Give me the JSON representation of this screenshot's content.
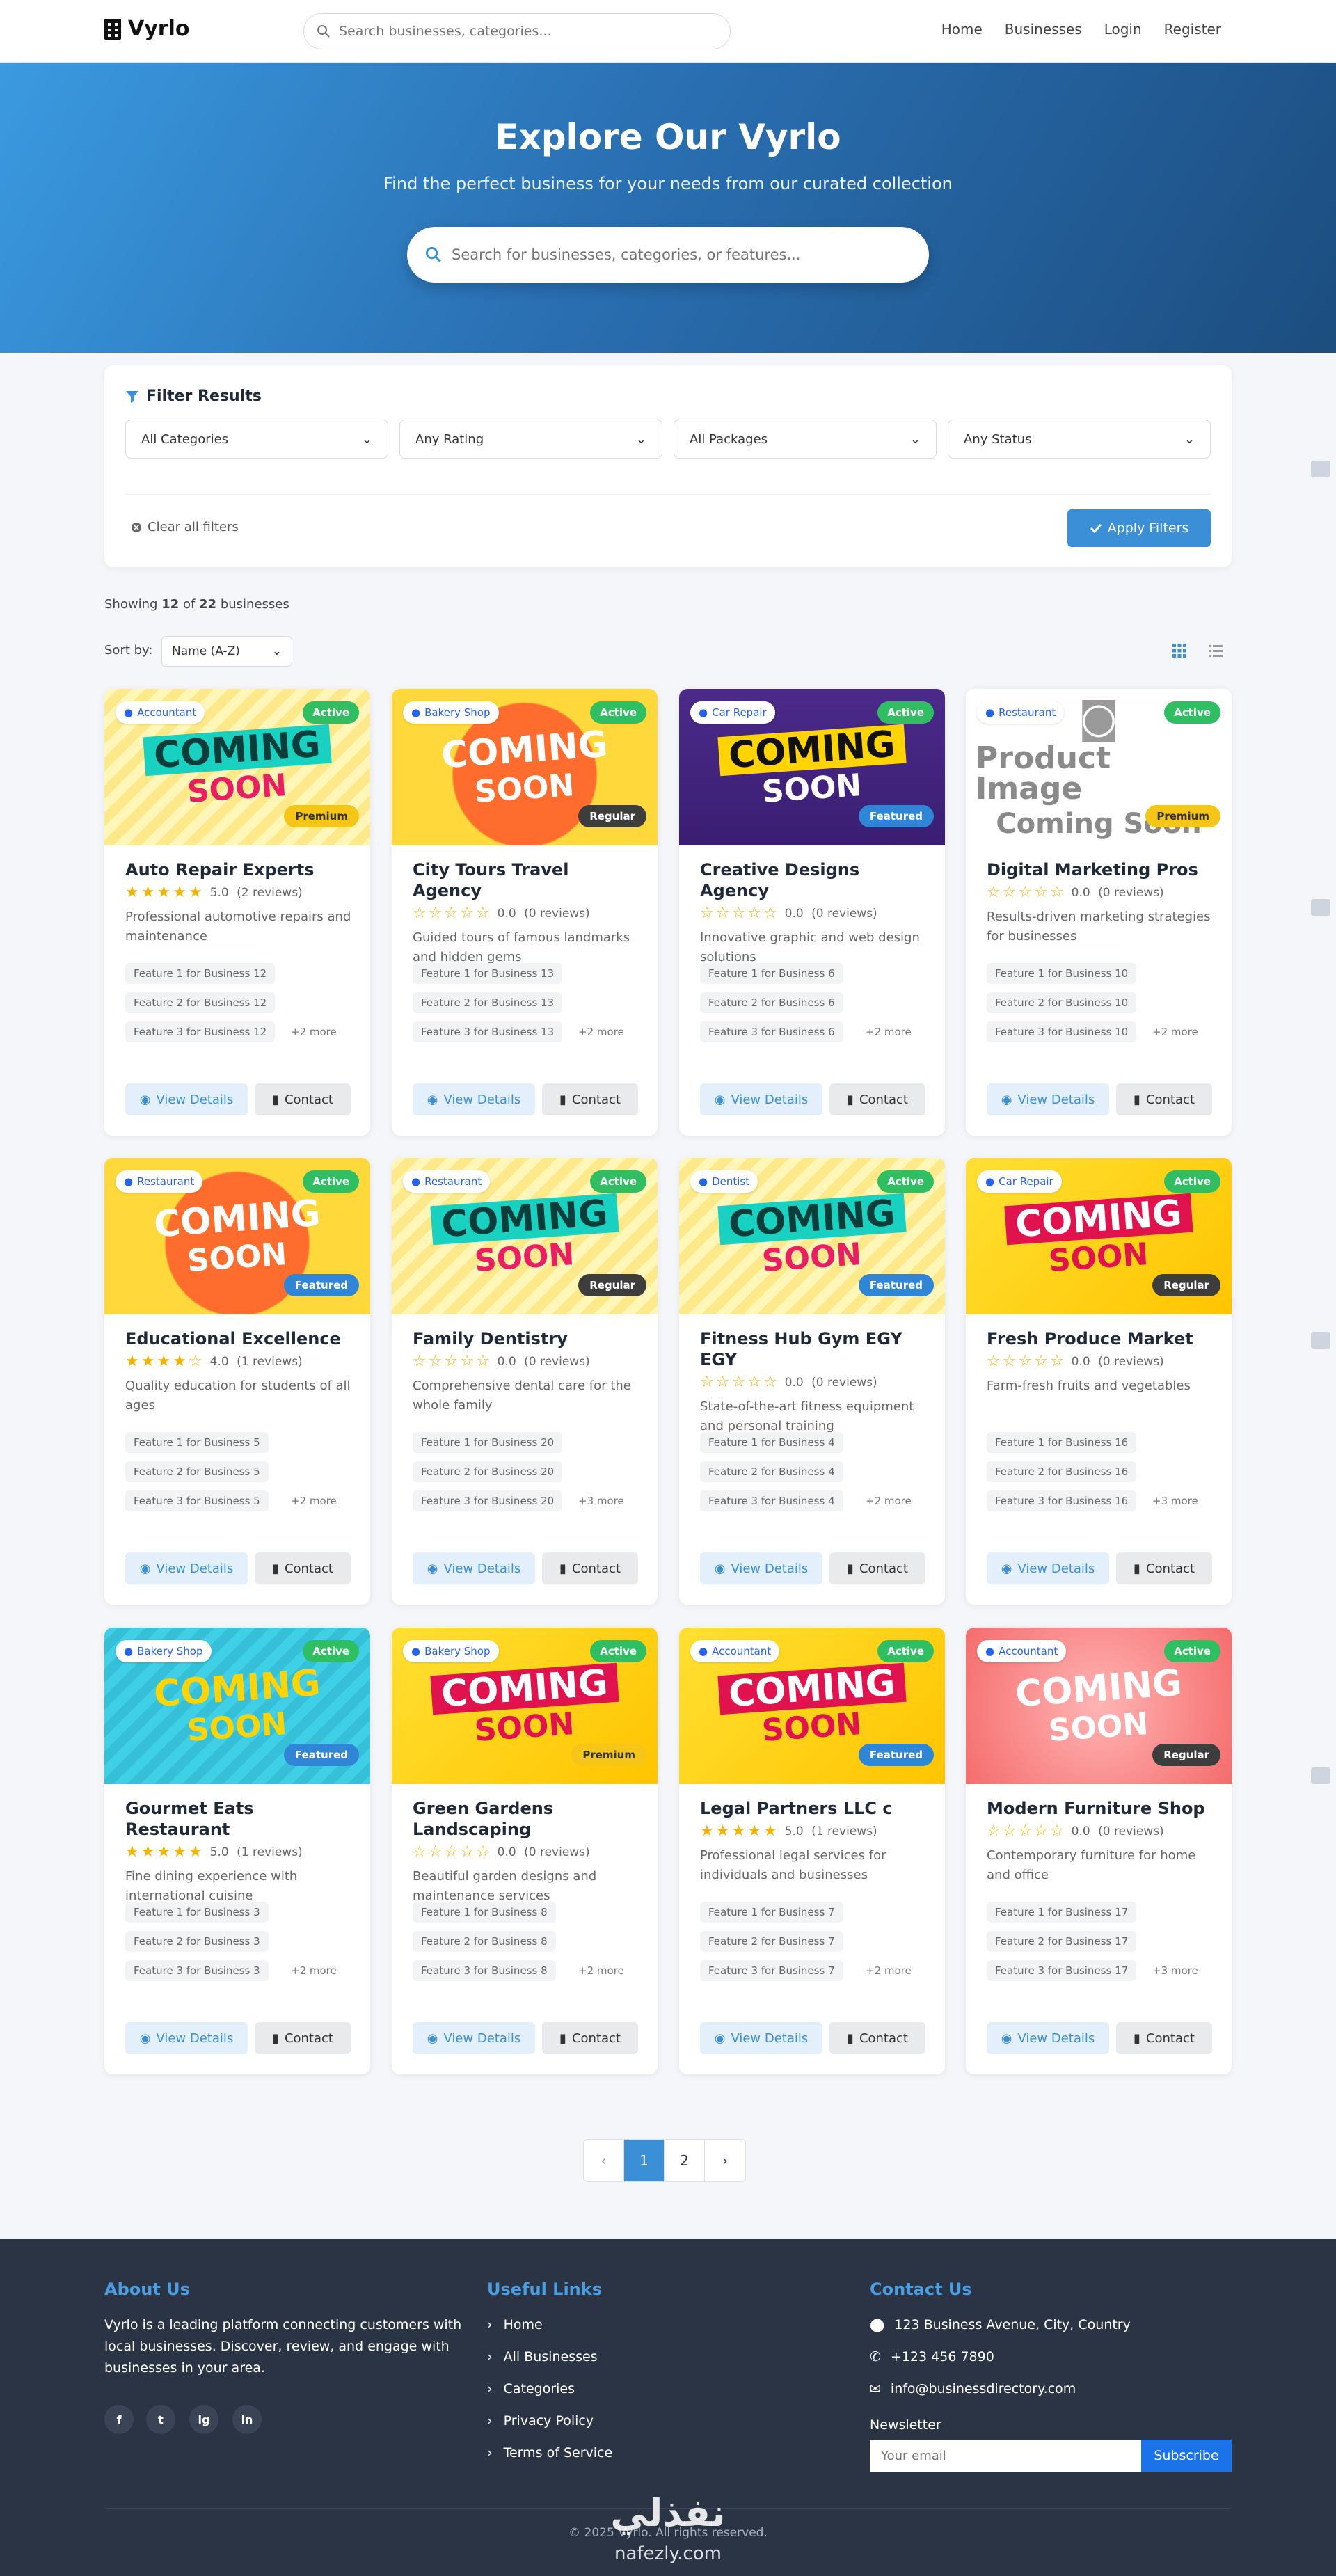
{
  "nav": {
    "logo": "Vyrlo",
    "search_placeholder": "Search businesses, categories...",
    "links": [
      "Home",
      "Businesses",
      "Login",
      "Register"
    ]
  },
  "hero": {
    "title": "Explore Our Vyrlo",
    "subtitle": "Find the perfect business for your needs from our curated collection",
    "search_placeholder": "Search for businesses, categories, or features..."
  },
  "filters": {
    "title": "Filter Results",
    "categories": "All Categories",
    "rating": "Any Rating",
    "packages": "All Packages",
    "status": "Any Status",
    "clear": "Clear all filters",
    "apply": "Apply Filters"
  },
  "results": {
    "showing_prefix": "Showing",
    "shown": "12",
    "of": "of",
    "total": "22",
    "suffix": "businesses",
    "sort_label": "Sort by:",
    "sort_value": "Name (A-Z)"
  },
  "actions": {
    "view": "View Details",
    "contact": "Contact"
  },
  "cards": [
    {
      "name": "Auto Repair Experts",
      "category": "Accountant",
      "status": "Active",
      "package": "Premium",
      "stars": 5,
      "rating": "5.0",
      "reviews": "(2 reviews)",
      "description": "Professional automotive repairs and maintenance",
      "features": [
        "Feature 1 for Business 12",
        "Feature 2 for Business 12",
        "Feature 3 for Business 12"
      ],
      "more": "+2 more",
      "image_text": [
        "COMING",
        "SOON"
      ]
    },
    {
      "name": "City Tours Travel Agency",
      "category": "Bakery Shop",
      "status": "Active",
      "package": "Regular",
      "stars": 0,
      "rating": "0.0",
      "reviews": "(0 reviews)",
      "description": "Guided tours of famous landmarks and hidden gems",
      "features": [
        "Feature 1 for Business 13",
        "Feature 2 for Business 13",
        "Feature 3 for Business 13"
      ],
      "more": "+2 more",
      "image_text": [
        "COMING",
        "SOON"
      ]
    },
    {
      "name": "Creative Designs Agency",
      "category": "Car Repair",
      "status": "Active",
      "package": "Featured",
      "stars": 0,
      "rating": "0.0",
      "reviews": "(0 reviews)",
      "description": "Innovative graphic and web design solutions",
      "features": [
        "Feature 1 for Business 6",
        "Feature 2 for Business 6",
        "Feature 3 for Business 6"
      ],
      "more": "+2 more",
      "image_text": [
        "COMING",
        "SOON"
      ]
    },
    {
      "name": "Digital Marketing Pros",
      "category": "Restaurant",
      "status": "Active",
      "package": "Premium",
      "stars": 0,
      "rating": "0.0",
      "reviews": "(0 reviews)",
      "description": "Results-driven marketing strategies for businesses",
      "features": [
        "Feature 1 for Business 10",
        "Feature 2 for Business 10",
        "Feature 3 for Business 10"
      ],
      "more": "+2 more",
      "image_text": [
        "Product Image",
        "Coming Soon"
      ]
    },
    {
      "name": "Educational Excellence",
      "category": "Restaurant",
      "status": "Active",
      "package": "Featured",
      "stars": 4,
      "rating": "4.0",
      "reviews": "(1 reviews)",
      "description": "Quality education for students of all ages",
      "features": [
        "Feature 1 for Business 5",
        "Feature 2 for Business 5",
        "Feature 3 for Business 5"
      ],
      "more": "+2 more",
      "image_text": [
        "COMING",
        "SOON"
      ]
    },
    {
      "name": "Family Dentistry",
      "category": "Restaurant",
      "status": "Active",
      "package": "Regular",
      "stars": 0,
      "rating": "0.0",
      "reviews": "(0 reviews)",
      "description": "Comprehensive dental care for the whole family",
      "features": [
        "Feature 1 for Business 20",
        "Feature 2 for Business 20",
        "Feature 3 for Business 20"
      ],
      "more": "+3 more",
      "image_text": [
        "COMING",
        "SOON"
      ]
    },
    {
      "name": "Fitness Hub Gym EGY EGY",
      "category": "Dentist",
      "status": "Active",
      "package": "Featured",
      "stars": 0,
      "rating": "0.0",
      "reviews": "(0 reviews)",
      "description": "State-of-the-art fitness equipment and personal training",
      "features": [
        "Feature 1 for Business 4",
        "Feature 2 for Business 4",
        "Feature 3 for Business 4"
      ],
      "more": "+2 more",
      "image_text": [
        "COMING",
        "SOON"
      ]
    },
    {
      "name": "Fresh Produce Market",
      "category": "Car Repair",
      "status": "Active",
      "package": "Regular",
      "stars": 0,
      "rating": "0.0",
      "reviews": "(0 reviews)",
      "description": "Farm-fresh fruits and vegetables",
      "features": [
        "Feature 1 for Business 16",
        "Feature 2 for Business 16",
        "Feature 3 for Business 16"
      ],
      "more": "+3 more",
      "image_text": [
        "COMING",
        "SOON"
      ]
    },
    {
      "name": "Gourmet Eats Restaurant",
      "category": "Bakery Shop",
      "status": "Active",
      "package": "Featured",
      "stars": 5,
      "rating": "5.0",
      "reviews": "(1 reviews)",
      "description": "Fine dining experience with international cuisine",
      "features": [
        "Feature 1 for Business 3",
        "Feature 2 for Business 3",
        "Feature 3 for Business 3"
      ],
      "more": "+2 more",
      "image_text": [
        "COMING",
        "SOON"
      ]
    },
    {
      "name": "Green Gardens Landscaping",
      "category": "Bakery Shop",
      "status": "Active",
      "package": "Premium",
      "stars": 0,
      "rating": "0.0",
      "reviews": "(0 reviews)",
      "description": "Beautiful garden designs and maintenance services",
      "features": [
        "Feature 1 for Business 8",
        "Feature 2 for Business 8",
        "Feature 3 for Business 8"
      ],
      "more": "+2 more",
      "image_text": [
        "COMING",
        "SOON"
      ]
    },
    {
      "name": "Legal Partners LLC c",
      "category": "Accountant",
      "status": "Active",
      "package": "Featured",
      "stars": 5,
      "rating": "5.0",
      "reviews": "(1 reviews)",
      "description": "Professional legal services for individuals and businesses",
      "features": [
        "Feature 1 for Business 7",
        "Feature 2 for Business 7",
        "Feature 3 for Business 7"
      ],
      "more": "+2 more",
      "image_text": [
        "COMING",
        "SOON"
      ]
    },
    {
      "name": "Modern Furniture Shop",
      "category": "Accountant",
      "status": "Active",
      "package": "Regular",
      "stars": 0,
      "rating": "0.0",
      "reviews": "(0 reviews)",
      "description": "Contemporary furniture for home and office",
      "features": [
        "Feature 1 for Business 17",
        "Feature 2 for Business 17",
        "Feature 3 for Business 17"
      ],
      "more": "+3 more",
      "image_text": [
        "COMING",
        "SOON"
      ]
    }
  ],
  "pagination": {
    "pages": [
      "1",
      "2"
    ],
    "active": "1"
  },
  "footer": {
    "about_title": "About Us",
    "about_text": "Vyrlo is a leading platform connecting customers with local businesses. Discover, review, and engage with businesses in your area.",
    "social": [
      "f",
      "t",
      "ig",
      "in"
    ],
    "links_title": "Useful Links",
    "links": [
      "Home",
      "All Businesses",
      "Categories",
      "Privacy Policy",
      "Terms of Service"
    ],
    "contact_title": "Contact Us",
    "address": "123 Business Avenue, City, Country",
    "phone": "+123 456 7890",
    "email": "info@businessdirectory.com",
    "newsletter": "Newsletter",
    "newsletter_placeholder": "Your email",
    "subscribe": "Subscribe",
    "copyright": "© 2025 Vyrlo. All rights reserved.",
    "watermark": "نفذلي",
    "watermark_url": "nafezly.com"
  },
  "colors": {
    "primary": "#3a8fd6",
    "active": "#2fbf62",
    "premium": "#f5c518",
    "regular": "#3d3d3d",
    "featured": "#2f86d6",
    "star": "#f5b301",
    "footer": "#2b3445"
  }
}
